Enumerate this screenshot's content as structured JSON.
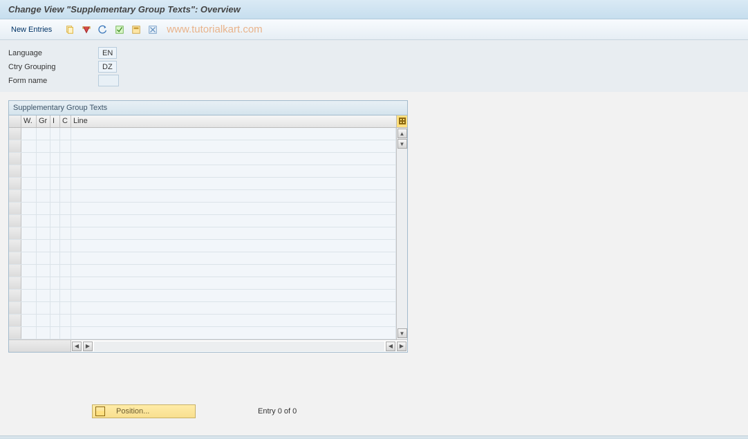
{
  "title": "Change View \"Supplementary Group Texts\": Overview",
  "toolbar": {
    "new_entries": "New Entries"
  },
  "watermark": "www.tutorialkart.com",
  "form": {
    "language": {
      "label": "Language",
      "value": "EN"
    },
    "ctry_grouping": {
      "label": "Ctry Grouping",
      "value": "DZ"
    },
    "form_name": {
      "label": "Form name",
      "value": ""
    }
  },
  "table": {
    "title": "Supplementary Group Texts",
    "columns": {
      "w": "W.",
      "gr": "Gr",
      "i": "I",
      "c": "C",
      "line": "Line"
    },
    "row_count": 17
  },
  "footer": {
    "position_label": "Position...",
    "entry_text": "Entry 0 of 0"
  }
}
